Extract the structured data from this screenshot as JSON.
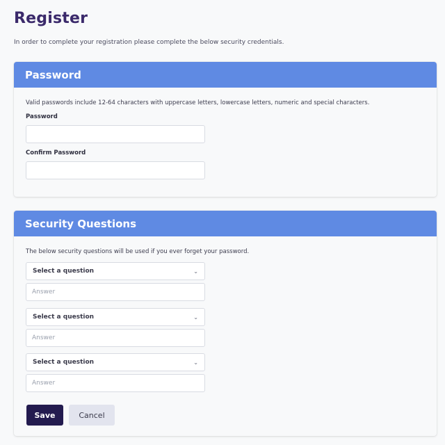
{
  "page": {
    "title": "Register",
    "intro": "In order to complete your registration please complete the below security credentials."
  },
  "password_section": {
    "header": "Password",
    "help": "Valid passwords include 12-64 characters with uppercase letters, lowercase letters, numeric and special characters.",
    "password_label": "Password",
    "password_value": "",
    "confirm_label": "Confirm Password",
    "confirm_value": ""
  },
  "security_section": {
    "header": "Security Questions",
    "help": "The below security questions will be used if you ever forget your password.",
    "questions": [
      {
        "select_value": "Select a question",
        "answer_placeholder": "Answer",
        "answer_value": ""
      },
      {
        "select_value": "Select a question",
        "answer_placeholder": "Answer",
        "answer_value": ""
      },
      {
        "select_value": "Select a question",
        "answer_placeholder": "Answer",
        "answer_value": ""
      }
    ]
  },
  "actions": {
    "save_label": "Save",
    "cancel_label": "Cancel"
  },
  "colors": {
    "title": "#3b2a6b",
    "section_header": "#5f8ae3",
    "save_button": "#231b4f",
    "cancel_button": "#e2e4ee"
  },
  "icons": {
    "select_chevron": "chevron-down-icon"
  }
}
